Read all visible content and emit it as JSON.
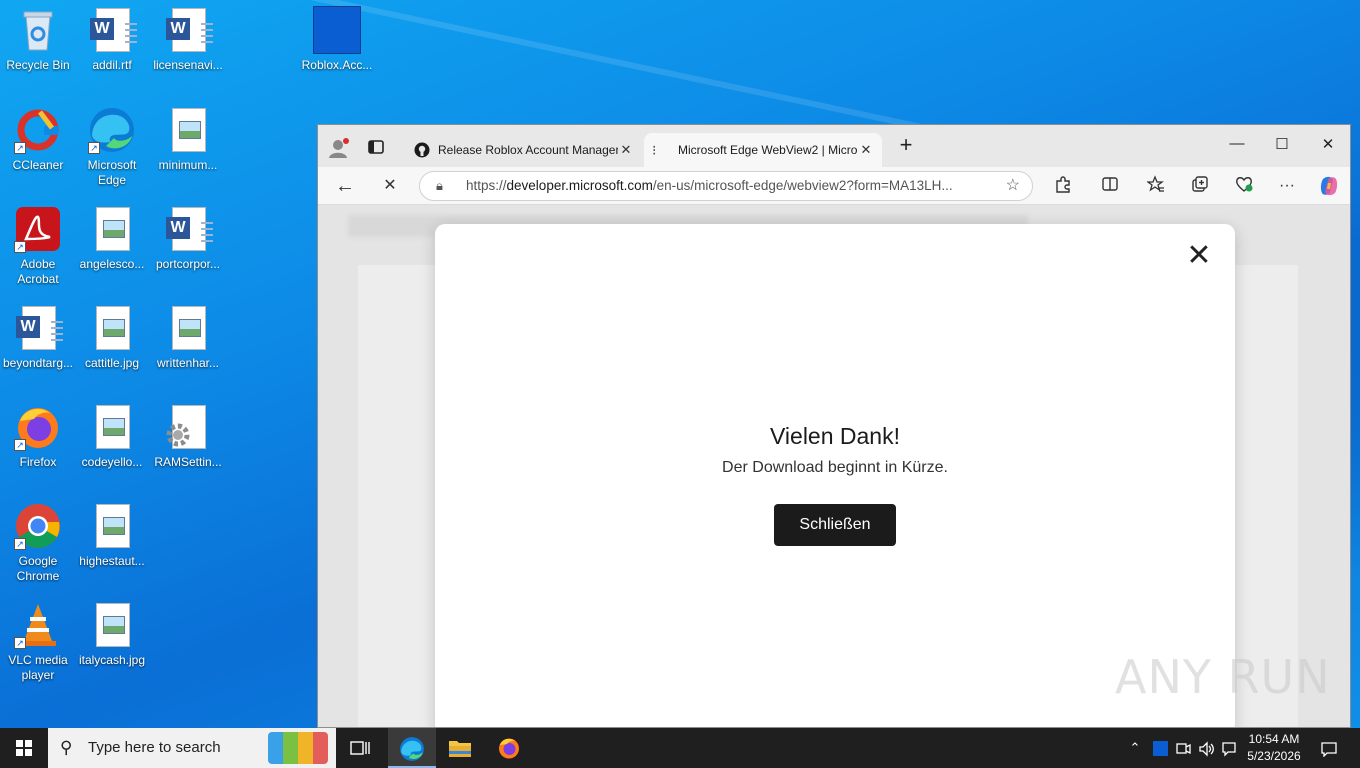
{
  "desktop": {
    "icons": [
      {
        "label": "Recycle Bin"
      },
      {
        "label": "addil.rtf"
      },
      {
        "label": "licensenavi..."
      },
      {
        "label": "Roblox.Acc..."
      },
      {
        "label": "CCleaner"
      },
      {
        "label": "Microsoft Edge"
      },
      {
        "label": "minimum..."
      },
      {
        "label": "Adobe Acrobat"
      },
      {
        "label": "angelesco..."
      },
      {
        "label": "portcorpor..."
      },
      {
        "label": "beyondtarg..."
      },
      {
        "label": "cattitle.jpg"
      },
      {
        "label": "writtenhar..."
      },
      {
        "label": "Firefox"
      },
      {
        "label": "codeyello..."
      },
      {
        "label": "RAMSettin..."
      },
      {
        "label": "Google Chrome"
      },
      {
        "label": "highestaut..."
      },
      {
        "label": "VLC media player"
      },
      {
        "label": "italycash.jpg"
      }
    ]
  },
  "browser": {
    "tabs": [
      {
        "title": "Release Roblox Account Manager",
        "close": "✕"
      },
      {
        "title": "Microsoft Edge WebView2 | Micro",
        "close": "✕"
      }
    ],
    "new_tab": "+",
    "window_controls": {
      "minimize": "—",
      "maximize": "☐",
      "close": "✕"
    },
    "url_prefix": "https://",
    "url_host": "developer.microsoft.com",
    "url_path": "/en-us/microsoft-edge/webview2?form=MA13LH...",
    "toolbar": {
      "back": "←",
      "stop": "✕",
      "more": "···"
    }
  },
  "modal": {
    "title": "Vielen Dank!",
    "message": "Der Download beginnt in Kürze.",
    "button_label": "Schließen",
    "close_glyph": "✕"
  },
  "watermark": "ANY RUN",
  "taskbar": {
    "search_placeholder": "Type here to search",
    "time": "10:54 AM",
    "date": "5/23/2026"
  }
}
